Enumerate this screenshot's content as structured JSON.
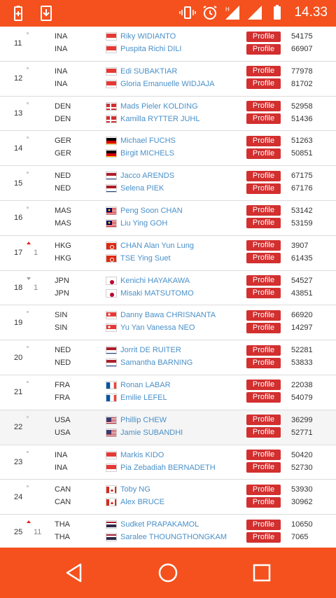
{
  "status_bar": {
    "time": "14.33",
    "icons": [
      "battery-plus-icon",
      "download-icon",
      "vibrate-icon",
      "alarm-icon",
      "signal-h-icon",
      "signal-icon",
      "battery-icon"
    ]
  },
  "profile_label": "Profile",
  "rows": [
    {
      "rank": "11",
      "move": "same",
      "change": "",
      "players": [
        {
          "country": "INA",
          "flag": "INA",
          "name": "Riky WIDIANTO",
          "points": "54175"
        },
        {
          "country": "INA",
          "flag": "INA",
          "name": "Puspita Richi DILI",
          "points": "66907"
        }
      ]
    },
    {
      "rank": "12",
      "move": "same",
      "change": "",
      "players": [
        {
          "country": "INA",
          "flag": "INA",
          "name": "Edi SUBAKTIAR",
          "points": "77978"
        },
        {
          "country": "INA",
          "flag": "INA",
          "name": "Gloria Emanuelle WIDJAJA",
          "points": "81702"
        }
      ]
    },
    {
      "rank": "13",
      "move": "same",
      "change": "",
      "players": [
        {
          "country": "DEN",
          "flag": "DEN",
          "name": "Mads Pieler KOLDING",
          "points": "52958"
        },
        {
          "country": "DEN",
          "flag": "DEN",
          "name": "Kamilla RYTTER JUHL",
          "points": "51436"
        }
      ]
    },
    {
      "rank": "14",
      "move": "same",
      "change": "",
      "players": [
        {
          "country": "GER",
          "flag": "GER",
          "name": "Michael FUCHS",
          "points": "51263"
        },
        {
          "country": "GER",
          "flag": "GER",
          "name": "Birgit MICHELS",
          "points": "50851"
        }
      ]
    },
    {
      "rank": "15",
      "move": "same",
      "change": "",
      "players": [
        {
          "country": "NED",
          "flag": "NED",
          "name": "Jacco ARENDS",
          "points": "67175"
        },
        {
          "country": "NED",
          "flag": "NED",
          "name": "Selena PIEK",
          "points": "67176"
        }
      ]
    },
    {
      "rank": "16",
      "move": "same",
      "change": "",
      "players": [
        {
          "country": "MAS",
          "flag": "MAS",
          "name": "Peng Soon CHAN",
          "points": "53142"
        },
        {
          "country": "MAS",
          "flag": "MAS",
          "name": "Liu Ying GOH",
          "points": "53159"
        }
      ]
    },
    {
      "rank": "17",
      "move": "up",
      "change": "1",
      "players": [
        {
          "country": "HKG",
          "flag": "HKG",
          "name": "CHAN Alan Yun Lung",
          "points": "3907"
        },
        {
          "country": "HKG",
          "flag": "HKG",
          "name": "TSE Ying Suet",
          "points": "61435"
        }
      ]
    },
    {
      "rank": "18",
      "move": "down",
      "change": "1",
      "players": [
        {
          "country": "JPN",
          "flag": "JPN",
          "name": "Kenichi HAYAKAWA",
          "points": "54527"
        },
        {
          "country": "JPN",
          "flag": "JPN",
          "name": "Misaki MATSUTOMO",
          "points": "43851"
        }
      ]
    },
    {
      "rank": "19",
      "move": "same",
      "change": "",
      "players": [
        {
          "country": "SIN",
          "flag": "SIN",
          "name": "Danny Bawa CHRISNANTA",
          "points": "66920"
        },
        {
          "country": "SIN",
          "flag": "SIN",
          "name": "Yu Yan Vanessa NEO",
          "points": "14297"
        }
      ]
    },
    {
      "rank": "20",
      "move": "same",
      "change": "",
      "players": [
        {
          "country": "NED",
          "flag": "NED",
          "name": "Jorrit DE RUITER",
          "points": "52281"
        },
        {
          "country": "NED",
          "flag": "NED",
          "name": "Samantha BARNING",
          "points": "53833"
        }
      ]
    },
    {
      "rank": "21",
      "move": "same",
      "change": "",
      "players": [
        {
          "country": "FRA",
          "flag": "FRA",
          "name": "Ronan LABAR",
          "points": "22038"
        },
        {
          "country": "FRA",
          "flag": "FRA",
          "name": "Emilie LEFEL",
          "points": "54079"
        }
      ]
    },
    {
      "rank": "22",
      "move": "same",
      "change": "",
      "players": [
        {
          "country": "USA",
          "flag": "USA",
          "name": "Phillip CHEW",
          "points": "36299"
        },
        {
          "country": "USA",
          "flag": "USA",
          "name": "Jamie SUBANDHI",
          "points": "52771"
        }
      ]
    },
    {
      "rank": "23",
      "move": "same",
      "change": "",
      "players": [
        {
          "country": "INA",
          "flag": "INA",
          "name": "Markis KIDO",
          "points": "50420"
        },
        {
          "country": "INA",
          "flag": "INA",
          "name": "Pia Zebadiah BERNADETH",
          "points": "52730"
        }
      ]
    },
    {
      "rank": "24",
      "move": "same",
      "change": "",
      "players": [
        {
          "country": "CAN",
          "flag": "CAN",
          "name": "Toby NG",
          "points": "53930"
        },
        {
          "country": "CAN",
          "flag": "CAN",
          "name": "Alex BRUCE",
          "points": "30962"
        }
      ]
    },
    {
      "rank": "25",
      "move": "up",
      "change": "11",
      "players": [
        {
          "country": "THA",
          "flag": "THA",
          "name": "Sudket PRAPAKAMOL",
          "points": "10650"
        },
        {
          "country": "THA",
          "flag": "THA",
          "name": "Saralee THOUNGTHONGKAM",
          "points": "7065"
        }
      ]
    }
  ],
  "nav_bar": {
    "buttons": [
      "back-icon",
      "home-icon",
      "recents-icon"
    ]
  }
}
